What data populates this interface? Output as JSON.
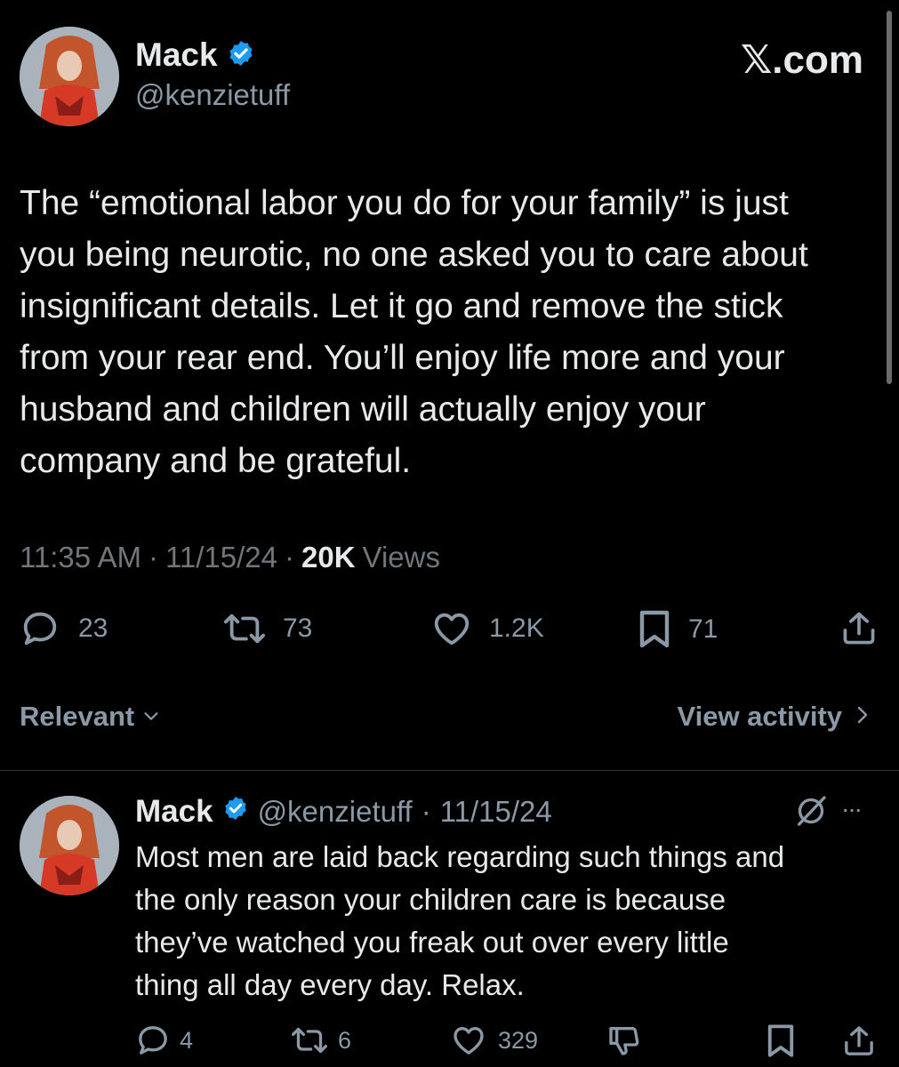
{
  "brand": {
    "label": "𝕏.com"
  },
  "post": {
    "author_name": "Mack",
    "handle": "@kenzietuff",
    "text_lines": [
      "The “emotional labor you do for your family” is just",
      "you being neurotic, no one asked you to care about",
      "insignificant details. Let it go and remove the stick",
      "from your rear end. You’ll enjoy life more and your",
      "husband and children will actually enjoy your",
      "company and be grateful."
    ],
    "time": "11:35 AM",
    "date": "11/15/24",
    "views_count": "20K",
    "views_label": "Views",
    "separator": "·",
    "stats": {
      "replies": "23",
      "reposts": "73",
      "likes": "1.2K",
      "bookmarks": "71"
    }
  },
  "sort": {
    "label": "Relevant",
    "chevron": "⌄"
  },
  "activity": {
    "label": "View activity",
    "chevron": "›"
  },
  "reply": {
    "author_name": "Mack",
    "handle": "@kenzietuff",
    "separator": "·",
    "date": "11/15/24",
    "more": "···",
    "text_lines": [
      "Most men are laid back regarding such things and",
      "the only reason your children care is because",
      "they’ve watched you freak out over every little",
      "thing all day every day. Relax."
    ],
    "stats": {
      "replies": "4",
      "reposts": "6",
      "likes": "329"
    }
  },
  "colors": {
    "background": "#000000",
    "text": "#e7e9ea",
    "muted": "#71767b",
    "verified": "#1d9bf0",
    "divider": "#2f3336"
  }
}
